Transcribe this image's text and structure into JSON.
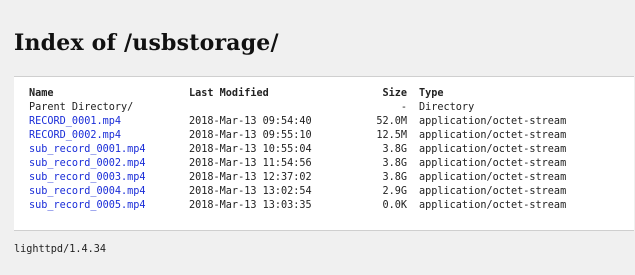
{
  "title": "Index of /usbstorage/",
  "columns": {
    "name": "Name",
    "last_modified": "Last Modified",
    "size": "Size",
    "type": "Type"
  },
  "rows": [
    {
      "name": "Parent Directory/",
      "modified": "",
      "size": "-",
      "type": "Directory",
      "link": false
    },
    {
      "name": "RECORD_0001.mp4",
      "modified": "2018-Mar-13 09:54:40",
      "size": "52.0M",
      "type": "application/octet-stream",
      "link": true
    },
    {
      "name": "RECORD_0002.mp4",
      "modified": "2018-Mar-13 09:55:10",
      "size": "12.5M",
      "type": "application/octet-stream",
      "link": true
    },
    {
      "name": "sub_record_0001.mp4",
      "modified": "2018-Mar-13 10:55:04",
      "size": "3.8G",
      "type": "application/octet-stream",
      "link": true
    },
    {
      "name": "sub_record_0002.mp4",
      "modified": "2018-Mar-13 11:54:56",
      "size": "3.8G",
      "type": "application/octet-stream",
      "link": true
    },
    {
      "name": "sub_record_0003.mp4",
      "modified": "2018-Mar-13 12:37:02",
      "size": "3.8G",
      "type": "application/octet-stream",
      "link": true
    },
    {
      "name": "sub_record_0004.mp4",
      "modified": "2018-Mar-13 13:02:54",
      "size": "2.9G",
      "type": "application/octet-stream",
      "link": true
    },
    {
      "name": "sub_record_0005.mp4",
      "modified": "2018-Mar-13 13:03:35",
      "size": "0.0K",
      "type": "application/octet-stream",
      "link": true
    }
  ],
  "footer": "lighttpd/1.4.34",
  "colors": {
    "link": "#1a2dd8",
    "background": "#f0f0f0",
    "panel": "#ffffff"
  }
}
